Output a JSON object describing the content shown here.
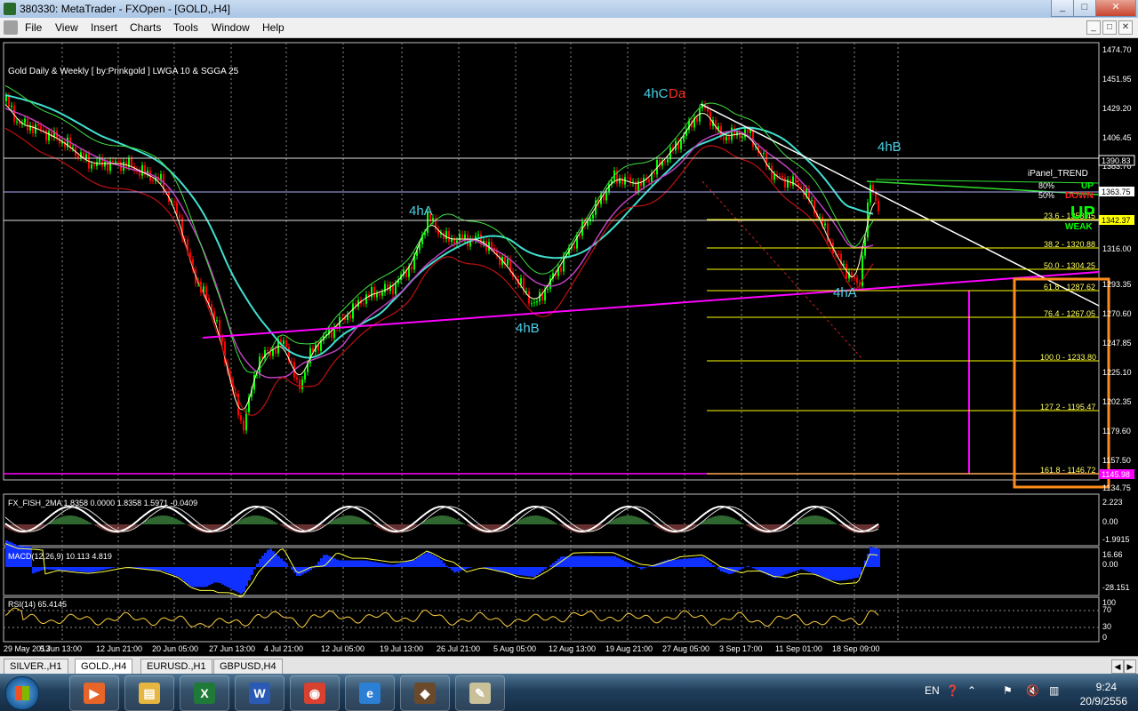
{
  "window": {
    "title": "380330: MetaTrader - FXOpen - [GOLD,,H4]",
    "buttons": [
      "_",
      "□",
      "✕"
    ]
  },
  "menu": {
    "items": [
      "File",
      "View",
      "Insert",
      "Charts",
      "Tools",
      "Window",
      "Help"
    ],
    "mdi_buttons": [
      "_",
      "□",
      "✕"
    ]
  },
  "chart": {
    "indicator_caption": "Gold Daily & Weekly [ by:Prinkgold ] LWGA 10  &  SGGA 25",
    "wave_labels": {
      "top_cyan": "4hC",
      "top_red": "Da",
      "left_a": "4hA",
      "mid_b": "4hB",
      "right_b": "4hB",
      "right_a": "4hA"
    },
    "price_scale": [
      "1474.70",
      "1451.95",
      "1429.20",
      "1406.45",
      "1383.70",
      "1363.75",
      "1342.37",
      "1316.00",
      "1293.35",
      "1270.60",
      "1247.85",
      "1225.10",
      "1202.35",
      "1179.60",
      "1157.50",
      "1134.75"
    ],
    "price_tags": {
      "current": "1363.75",
      "level_1390": "1390.83",
      "yellow": "1342.37",
      "magenta": "1145.98"
    },
    "fib_levels": [
      {
        "label": "23.6 - 1353.45"
      },
      {
        "label": "38.2 - 1320.88"
      },
      {
        "label": "50.0 - 1304.25"
      },
      {
        "label": "61.8 - 1287.62"
      },
      {
        "label": "76.4 - 1267.05"
      },
      {
        "label": "100.0 - 1233.80"
      },
      {
        "label": "127.2 - 1195.47"
      },
      {
        "label": "161.8 - 1146.72"
      }
    ],
    "ipanel": {
      "title": "iPanel_TREND",
      "rows": [
        {
          "pct": "80%",
          "value": "UP",
          "color": "#00ff00"
        },
        {
          "pct": "50%",
          "value": "DOWN",
          "color": "#ff2020"
        }
      ],
      "big": "UP",
      "sub": "WEAK"
    },
    "date_axis": [
      "29 May 2013",
      "5 Jun 13:00",
      "12 Jun 21:00",
      "20 Jun 05:00",
      "27 Jun 13:00",
      "4 Jul 21:00",
      "12 Jul 05:00",
      "19 Jul 13:00",
      "26 Jul 21:00",
      "5 Aug 05:00",
      "12 Aug 13:00",
      "19 Aug 21:00",
      "27 Aug 05:00",
      "3 Sep 17:00",
      "11 Sep 01:00",
      "18 Sep 09:00"
    ]
  },
  "subwindows": {
    "fisher": {
      "caption": "FX_FISH_2MA 1.8358 0.0000 1.8358 1.5971 -0.0409",
      "scale": [
        "2.223",
        "0.00",
        "-1.9915"
      ]
    },
    "macd": {
      "caption": "MACD(12,26,9) 10.113 4.819",
      "scale": [
        "16.66",
        "0.00",
        "-28.151"
      ]
    },
    "rsi": {
      "caption": "RSI(14) 65.4145",
      "scale": [
        "100",
        "70",
        "30",
        "0"
      ]
    }
  },
  "tabs": [
    "SILVER.,H1",
    "GOLD.,H4",
    "EURUSD.,H1",
    "GBPUSD,H4"
  ],
  "active_tab": 1,
  "taskbar": {
    "language": "EN",
    "time": "9:24",
    "date": "20/9/2556",
    "apps": [
      {
        "name": "media-player-icon",
        "glyph": "▶",
        "color": "#e8652a"
      },
      {
        "name": "file-explorer-icon",
        "glyph": "▤",
        "color": "#e7b640"
      },
      {
        "name": "excel-icon",
        "glyph": "X",
        "color": "#1f7a3a"
      },
      {
        "name": "word-icon",
        "glyph": "W",
        "color": "#2a5ab4"
      },
      {
        "name": "chrome-icon",
        "glyph": "◉",
        "color": "#d8412f"
      },
      {
        "name": "internet-explorer-icon",
        "glyph": "e",
        "color": "#2b7fd4"
      },
      {
        "name": "metatrader-icon",
        "glyph": "◆",
        "color": "#6a4a2a"
      },
      {
        "name": "paint-icon",
        "glyph": "✎",
        "color": "#c9c09a"
      }
    ]
  },
  "colors": {
    "background": "#000000",
    "bull_candle": "#00ff00",
    "bear_candle": "#ff0000",
    "fib": "#ffff00",
    "trendline_magenta": "#ff00ff",
    "trendline_white": "#ffffff",
    "box_orange": "#ff8c1a",
    "ma_cyan": "#40e0d0"
  }
}
